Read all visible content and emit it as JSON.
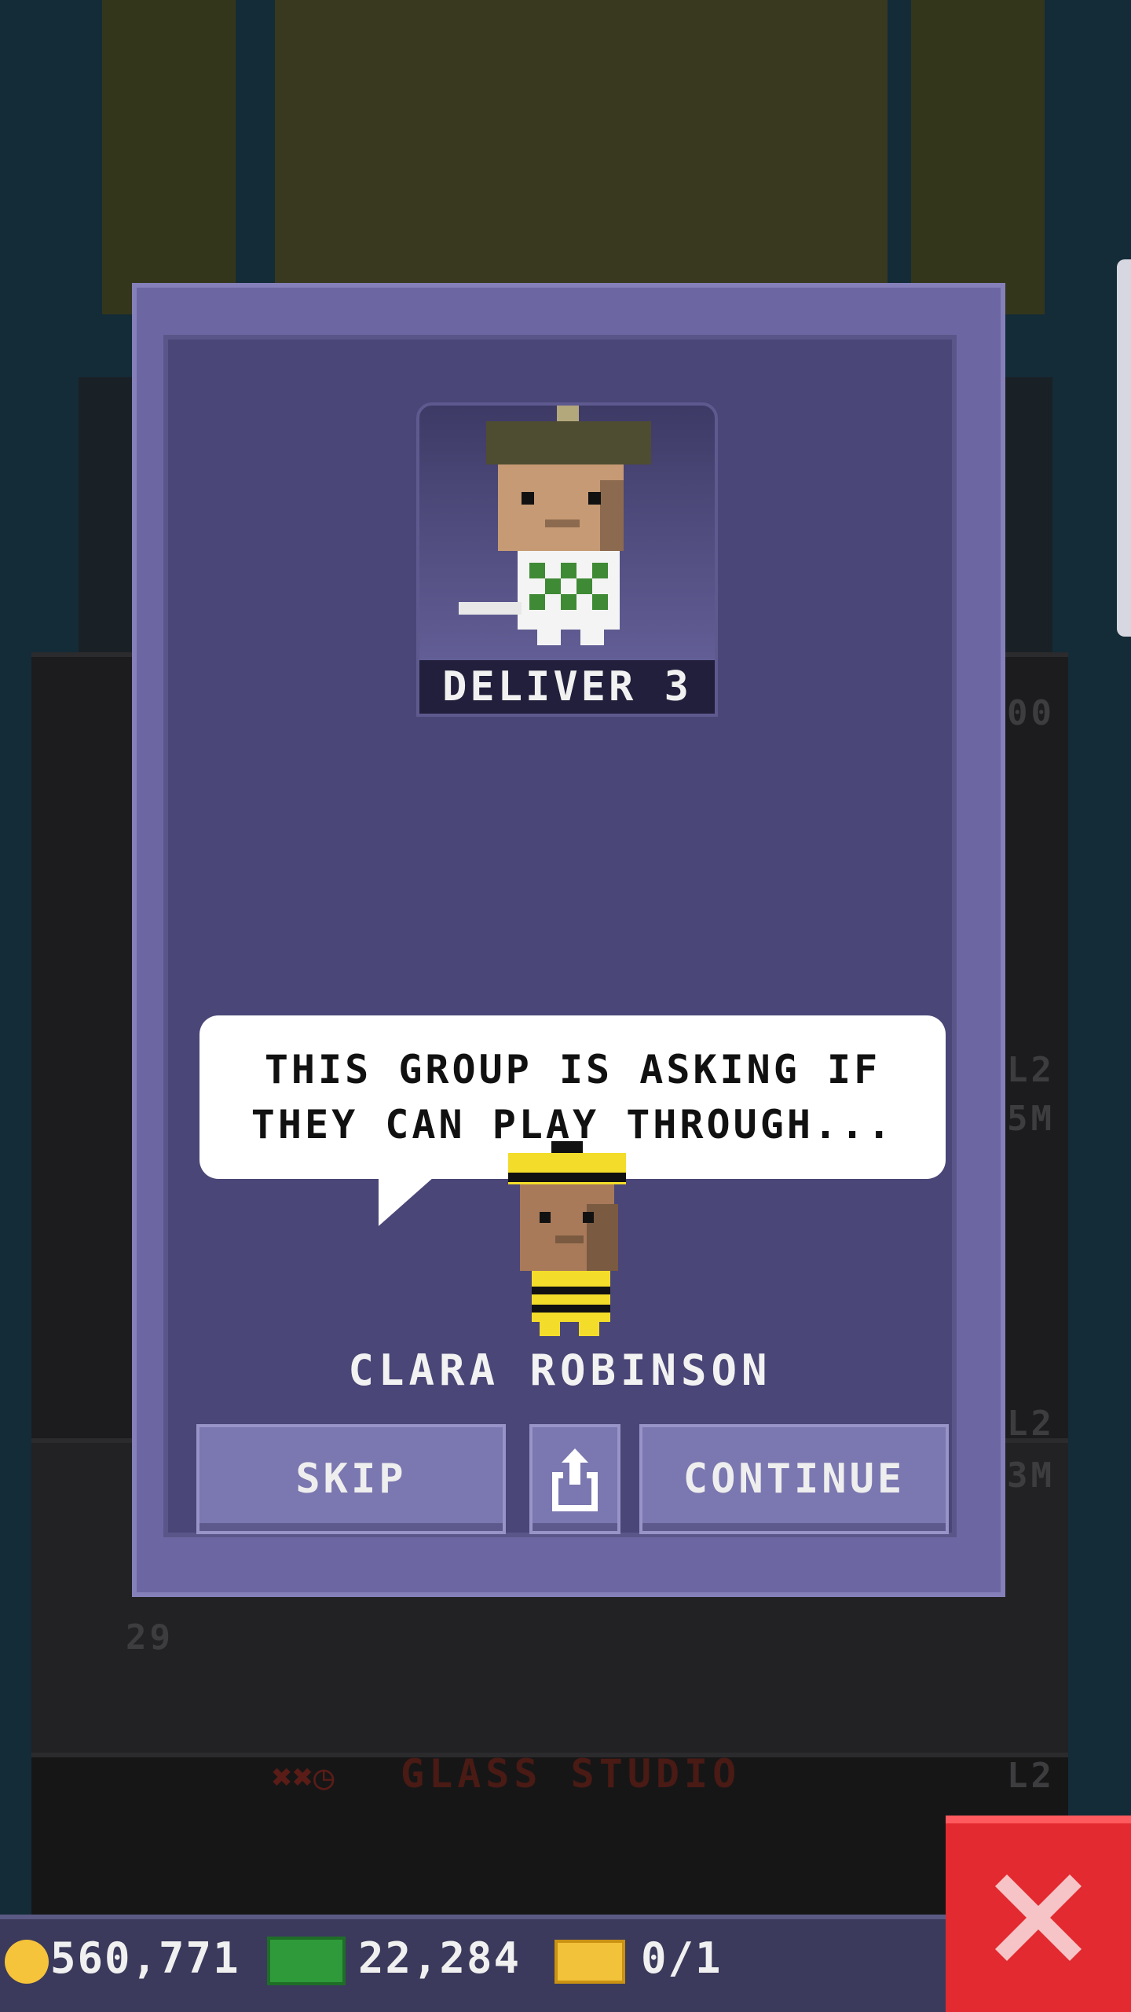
{
  "dialog": {
    "mission_label": "DELIVER 3",
    "speech_line_1": "THIS GROUP IS ASKING IF",
    "speech_line_2": "THEY CAN PLAY THROUGH...",
    "speaker_name": "CLARA ROBINSON",
    "skip_label": "SKIP",
    "continue_label": "CONTINUE",
    "share_icon": "share-icon"
  },
  "background": {
    "floor_name": "GLASS STUDIO",
    "floor_level_a": "L2",
    "floor_level_b": "L2",
    "floor_level_c": "L2",
    "floor_code_a": "5M",
    "floor_code_b": "3M",
    "floor_number": "29",
    "floor_number_b": "00"
  },
  "hud": {
    "coins": "560,771",
    "bux": "22,284",
    "tickets": "0/1"
  },
  "colors": {
    "dialog_panel": "#4a4677",
    "dialog_border": "#6c67a3",
    "close_button": "#e22a30",
    "hud_bar": "#3b3a5c"
  }
}
